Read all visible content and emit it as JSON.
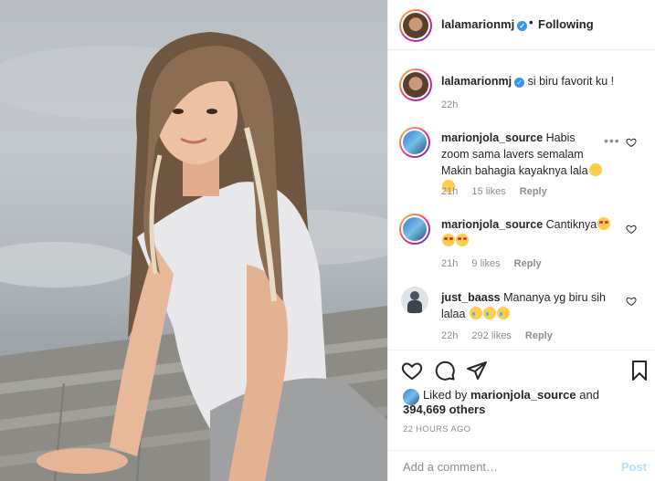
{
  "post": {
    "username": "lalamarionmj",
    "follow_state": "Following",
    "separator": "•",
    "verified_icon": "verified-badge-icon",
    "more_icon": "more-options-icon"
  },
  "caption": {
    "username": "lalamarionmj",
    "text": "si biru favorit ku !",
    "time": "22h"
  },
  "comments": [
    {
      "username": "marionjola_source",
      "text": "Habis zoom sama lavers semalam Makin bahagia kayaknya lala",
      "emojis": [
        "face-savoring-icon",
        "face-savoring-icon"
      ],
      "time": "21h",
      "likes": "15 likes",
      "reply": "Reply"
    },
    {
      "username": "marionjola_source",
      "text": "Cantiknya",
      "emojis": [
        "heart-eyes-icon",
        "heart-eyes-icon",
        "heart-eyes-icon"
      ],
      "time": "21h",
      "likes": "9 likes",
      "reply": "Reply"
    },
    {
      "username": "just_baass",
      "text": "Mananya yg biru sih lalaa",
      "emojis": [
        "crying-face-icon",
        "crying-face-icon",
        "crying-face-icon"
      ],
      "time": "22h",
      "likes": "292 likes",
      "reply": "Reply"
    }
  ],
  "likes": {
    "prefix": "Liked by",
    "user": "marionjola_source",
    "and": "and",
    "others": "394,669 others"
  },
  "timestamp": "22 HOURS AGO",
  "add_comment": {
    "placeholder": "Add a comment…",
    "post_label": "Post"
  },
  "colors": {
    "accent": "#3897f0",
    "post_disabled": "#b2dffc",
    "muted": "#8e8e8e",
    "text": "#262626"
  }
}
